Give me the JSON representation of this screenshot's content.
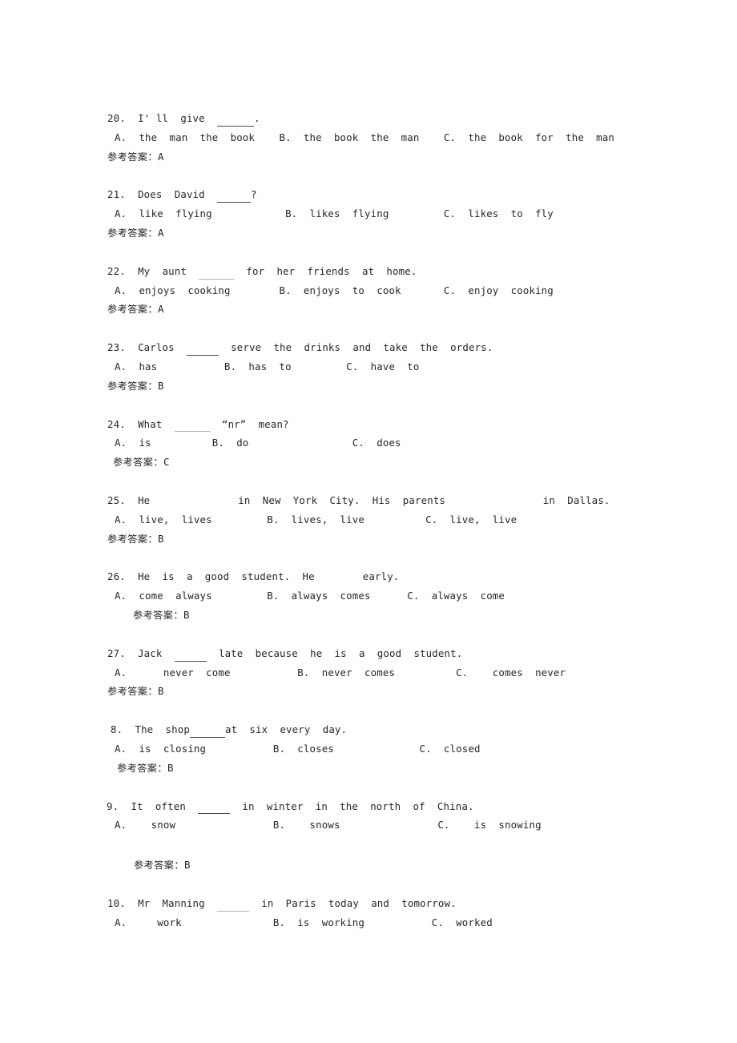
{
  "document": {
    "language_note_label": "参考答案：",
    "questions": [
      {
        "number": "20.",
        "stem_before": "  I' ll  give  ",
        "blank_style": "solid",
        "blank_width": 46,
        "stem_after": ".",
        "options": "A.  the  man  the  book    B.  the  book  the  man    C.  the  book  for  the  man",
        "answer_label": "参考答案：",
        "answer": "A",
        "answer_indent": "none",
        "stem_indent": "none",
        "extra_gap": false
      },
      {
        "number": "21.",
        "stem_before": "  Does  David  ",
        "blank_style": "solid",
        "blank_width": 42,
        "stem_after": "?",
        "options": "A.  like  flying            B.  likes  flying         C.  likes  to  fly",
        "answer_label": "参考答案：",
        "answer": "A",
        "answer_indent": "none",
        "stem_indent": "none",
        "extra_gap": false
      },
      {
        "number": "22.",
        "stem_before": "  My  aunt  ",
        "blank_style": "faint",
        "blank_width": 44,
        "stem_after": "  for  her  friends  at  home.",
        "options": "A.  enjoys  cooking        B.  enjoys  to  cook       C.  enjoy  cooking",
        "answer_label": "参考答案：",
        "answer": "A",
        "answer_indent": "none",
        "stem_indent": "none",
        "extra_gap": false
      },
      {
        "number": "23.",
        "stem_before": "  Carlos  ",
        "blank_style": "solid",
        "blank_width": 40,
        "stem_after": "  serve  the  drinks  and  take  the  orders.",
        "options": "A.  has           B.  has  to         C.  have  to",
        "answer_label": "参考答案：",
        "answer": "B",
        "answer_indent": "none",
        "stem_indent": "none",
        "extra_gap": false
      },
      {
        "number": "24.",
        "stem_before": "  What  ",
        "blank_style": "faint",
        "blank_width": 44,
        "stem_after": "  “nr”  mean?",
        "options": "A.  is          B.  do                 C.  does",
        "answer_label": "参考答案：",
        "answer": "C",
        "answer_indent": "small",
        "stem_indent": "none",
        "extra_gap": false
      },
      {
        "number": "25.",
        "stem_before": "  He",
        "blank_style": "none",
        "blank_width": 110,
        "stem_after": "in  New  York  City.  His  parents                in  Dallas.",
        "options": "A.  live,  lives         B.  lives,  live          C.  live,  live",
        "answer_label": "参考答案：",
        "answer": "B",
        "answer_indent": "none",
        "stem_indent": "none",
        "extra_gap": false
      },
      {
        "number": "26.",
        "stem_before": "  He  is  a  good  student.  He",
        "blank_style": "none",
        "blank_width": 60,
        "stem_after": "early.",
        "options": "A.  come  always         B.  always  comes      C.  always  come",
        "answer_label": "参考答案：",
        "answer": "B",
        "answer_indent": "large",
        "stem_indent": "none",
        "extra_gap": false
      },
      {
        "number": "27.",
        "stem_before": "  Jack  ",
        "blank_style": "solid",
        "blank_width": 40,
        "stem_after": "  late  because  he  is  a  good  student.",
        "options": "A.      never  come           B.  never  comes          C.    comes  never",
        "answer_label": "参考答案：",
        "answer": "B",
        "answer_indent": "none",
        "stem_indent": "none",
        "extra_gap": false
      },
      {
        "number": "8.",
        "stem_before": "  The  shop",
        "blank_style": "solid",
        "blank_width": 44,
        "stem_after": "at  six  every  day.",
        "options": "A.  is  closing           B.  closes              C.  closed",
        "answer_label": "参考答案：",
        "answer": "B",
        "answer_indent": "medium",
        "stem_indent": "small",
        "extra_gap": false
      },
      {
        "number": "9.",
        "stem_before": "  It  often  ",
        "blank_style": "solid",
        "blank_width": 40,
        "stem_after": "  in  winter  in  the  north  of  China.",
        "options": "A.    snow                B.    snows                C.    is  snowing",
        "answer_label": "参考答案：",
        "answer": "B",
        "answer_indent": "xlarge",
        "stem_indent": "tiny",
        "extra_gap": true
      },
      {
        "number": "10.",
        "stem_before": "  Mr  Manning  ",
        "blank_style": "faint",
        "blank_width": 40,
        "stem_after": "  in  Paris  today  and  tomorrow.",
        "options": "A.     work               B.  is  working           C.  worked",
        "answer_label": "",
        "answer": "",
        "answer_indent": "none",
        "stem_indent": "none",
        "extra_gap": false
      }
    ]
  }
}
